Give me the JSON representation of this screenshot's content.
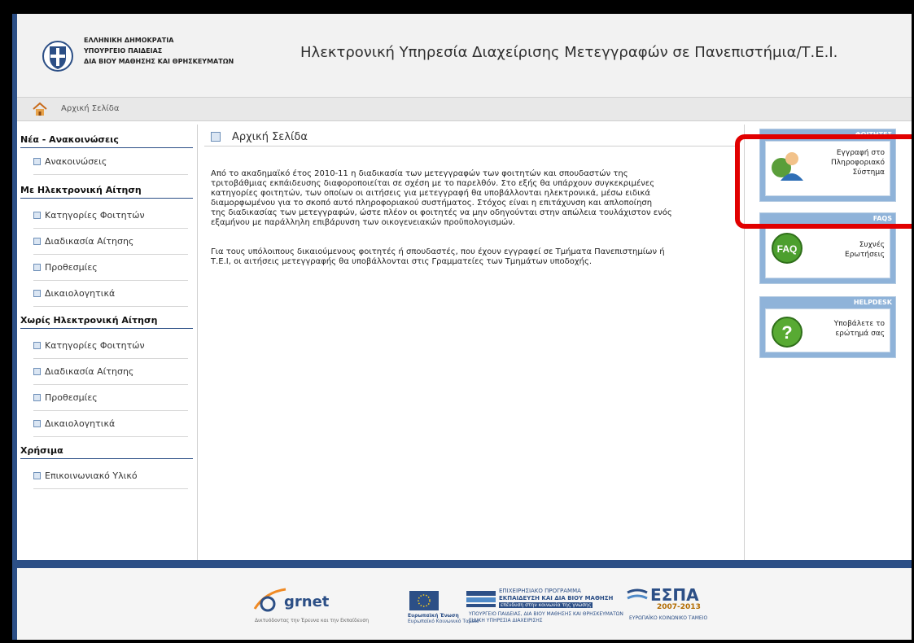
{
  "header": {
    "ministry_lines": [
      "ΕΛΛΗΝΙΚΗ ΔΗΜΟΚΡΑΤΙΑ",
      "ΥΠΟΥΡΓΕΙΟ ΠΑΙΔΕΙΑΣ",
      "ΔΙΑ ΒΙΟΥ ΜΑΘΗΣΗΣ ΚΑΙ ΘΡΗΣΚΕΥΜΑΤΩΝ"
    ],
    "site_title": "Ηλεκτρονική Υπηρεσία Διαχείρισης Μετεγγραφών σε Πανεπιστήμια/Τ.Ε.Ι."
  },
  "breadcrumb": {
    "home_icon": "home-icon",
    "label": "Αρχική Σελίδα"
  },
  "sidebar": {
    "sections": [
      {
        "title": "Νέα - Ανακοινώσεις",
        "items": [
          "Ανακοινώσεις"
        ]
      },
      {
        "title": "Με Ηλεκτρονική Αίτηση",
        "items": [
          "Κατηγορίες Φοιτητών",
          "Διαδικασία Αίτησης",
          "Προθεσμίες",
          "Δικαιολογητικά"
        ]
      },
      {
        "title": "Χωρίς Ηλεκτρονική Αίτηση",
        "items": [
          "Κατηγορίες Φοιτητών",
          "Διαδικασία Αίτησης",
          "Προθεσμίες",
          "Δικαιολογητικά"
        ]
      },
      {
        "title": "Χρήσιμα",
        "items": [
          "Επικοινωνιακό Υλικό"
        ]
      }
    ]
  },
  "main": {
    "title": "Αρχική Σελίδα",
    "para1": [
      "Από το ακαδημαϊκό έτος 2010-11 η διαδικασία των μετεγγραφών των φοιτητών και σπουδαστών της",
      "τριτοβάθμιας εκπάιδευσης διαφοροποιείται σε σχέση με το παρελθόν. Στο εξής θα υπάρχουν συγκεκριμένες",
      "κατηγορίες φοιτητών, των οποίων οι αιτήσεις για μετεγγραφή θα υποβάλλονται ηλεκτρονικά, μέσω ειδικά",
      "διαμορφωμένου για το σκοπό αυτό πληροφοριακού συστήματος. Στόχος είναι η επιτάχυνση και απλοποίηση",
      "της διαδικασίας των μετεγγραφών, ώστε πλέον οι φοιτητές να μην οδηγούνται στην απώλεια τουλάχιστον ενός",
      "εξαμήνου με παράλληλη επιβάρυνση των οικογενειακών προϋπολογισμών."
    ],
    "para2": [
      "Για τους υπόλοιπους δικαιούμενους φοιτητές ή σπουδαστές, που έχουν εγγραφεί σε Τμήματα Πανεπιστημίων ή",
      "Τ.Ε.Ι, οι αιτήσεις μετεγγραφής θα υποβάλλονται στις Γραμματείες των Τμημάτων υποδοχής."
    ]
  },
  "right_panel": {
    "students": {
      "tag": "ΦΟΙΤΗΤΕΣ",
      "label_lines": [
        "Εγγραφή στο",
        "Πληροφοριακό",
        "Σύστημα"
      ],
      "icon": "student-user-icon"
    },
    "faq": {
      "tag": "FAQS",
      "label_lines": [
        "Συχνές",
        "Ερωτήσεις"
      ],
      "icon": "faq-icon"
    },
    "helpdesk": {
      "tag": "HELPDESK",
      "label_lines": [
        "Υποβάλετε το",
        "ερώτημά σας"
      ],
      "icon": "question-icon"
    }
  },
  "footer": {
    "grnet_label": "grnet",
    "grnet_tagline": "Δικτυόδοντας την Έρευνα και την Εκπαίδευση",
    "eu_label": "Ευρωπαϊκή Ένωση",
    "eu_sub": "Ευρωπαϊκό Κοινωνικό Ταμείο",
    "program_lines": [
      "ΕΠΙΧΕΙΡΗΣΙΑΚΟ ΠΡΟΓΡΑΜΜΑ",
      "ΕΚΠΑΙΔΕΥΣΗ ΚΑΙ ΔΙΑ ΒΙΟΥ ΜΑΘΗΣΗ",
      "επένδυση στην κοινωνία της γνώσης",
      "ΥΠΟΥΡΓΕΙΟ ΠΑΙΔΕΙΑΣ, ΔΙΑ ΒΙΟΥ ΜΑΘΗΣΗΣ ΚΑΙ ΘΡΗΣΚΕΥΜΑΤΩΝ",
      "ΕΙΔΙΚΗ ΥΠΗΡΕΣΙΑ ΔΙΑΧΕΙΡΙΣΗΣ"
    ],
    "espa_title": "ΕΣΠΑ",
    "espa_years": "2007-2013",
    "espa_sub": "ΕΥΡΩΠΑΪΚΟ ΚΟΙΝΩΝΙΚΟ ΤΑΜΕΙΟ"
  }
}
